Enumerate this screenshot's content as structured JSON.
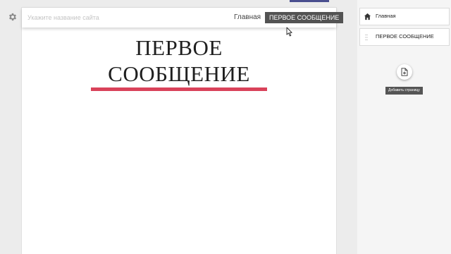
{
  "editor": {
    "site_name_placeholder": "Укажите название сайта",
    "site_name_value": ""
  },
  "nav": {
    "home_label": "Главная",
    "active_label": "ПЕРВОЕ СООБЩЕНИЕ"
  },
  "page": {
    "title_line1": "ПЕРВОЕ",
    "title_line2": "СООБЩЕНИЕ",
    "underline_color": "#d9425a"
  },
  "sidebar": {
    "pages": [
      {
        "label": "Главная",
        "icon": "home-icon"
      },
      {
        "label": "ПЕРВОЕ СООБЩЕНИЕ",
        "icon": "drag-handle-icon"
      }
    ],
    "add_page_icon": "add-page-icon",
    "add_page_tooltip": "Добавить страницу"
  },
  "icons": {
    "settings": "gear-icon",
    "cursor": "mouse-pointer-icon"
  },
  "colors": {
    "accent": "#4a4f8f",
    "active_nav_bg": "#535353",
    "underline": "#d9425a"
  }
}
